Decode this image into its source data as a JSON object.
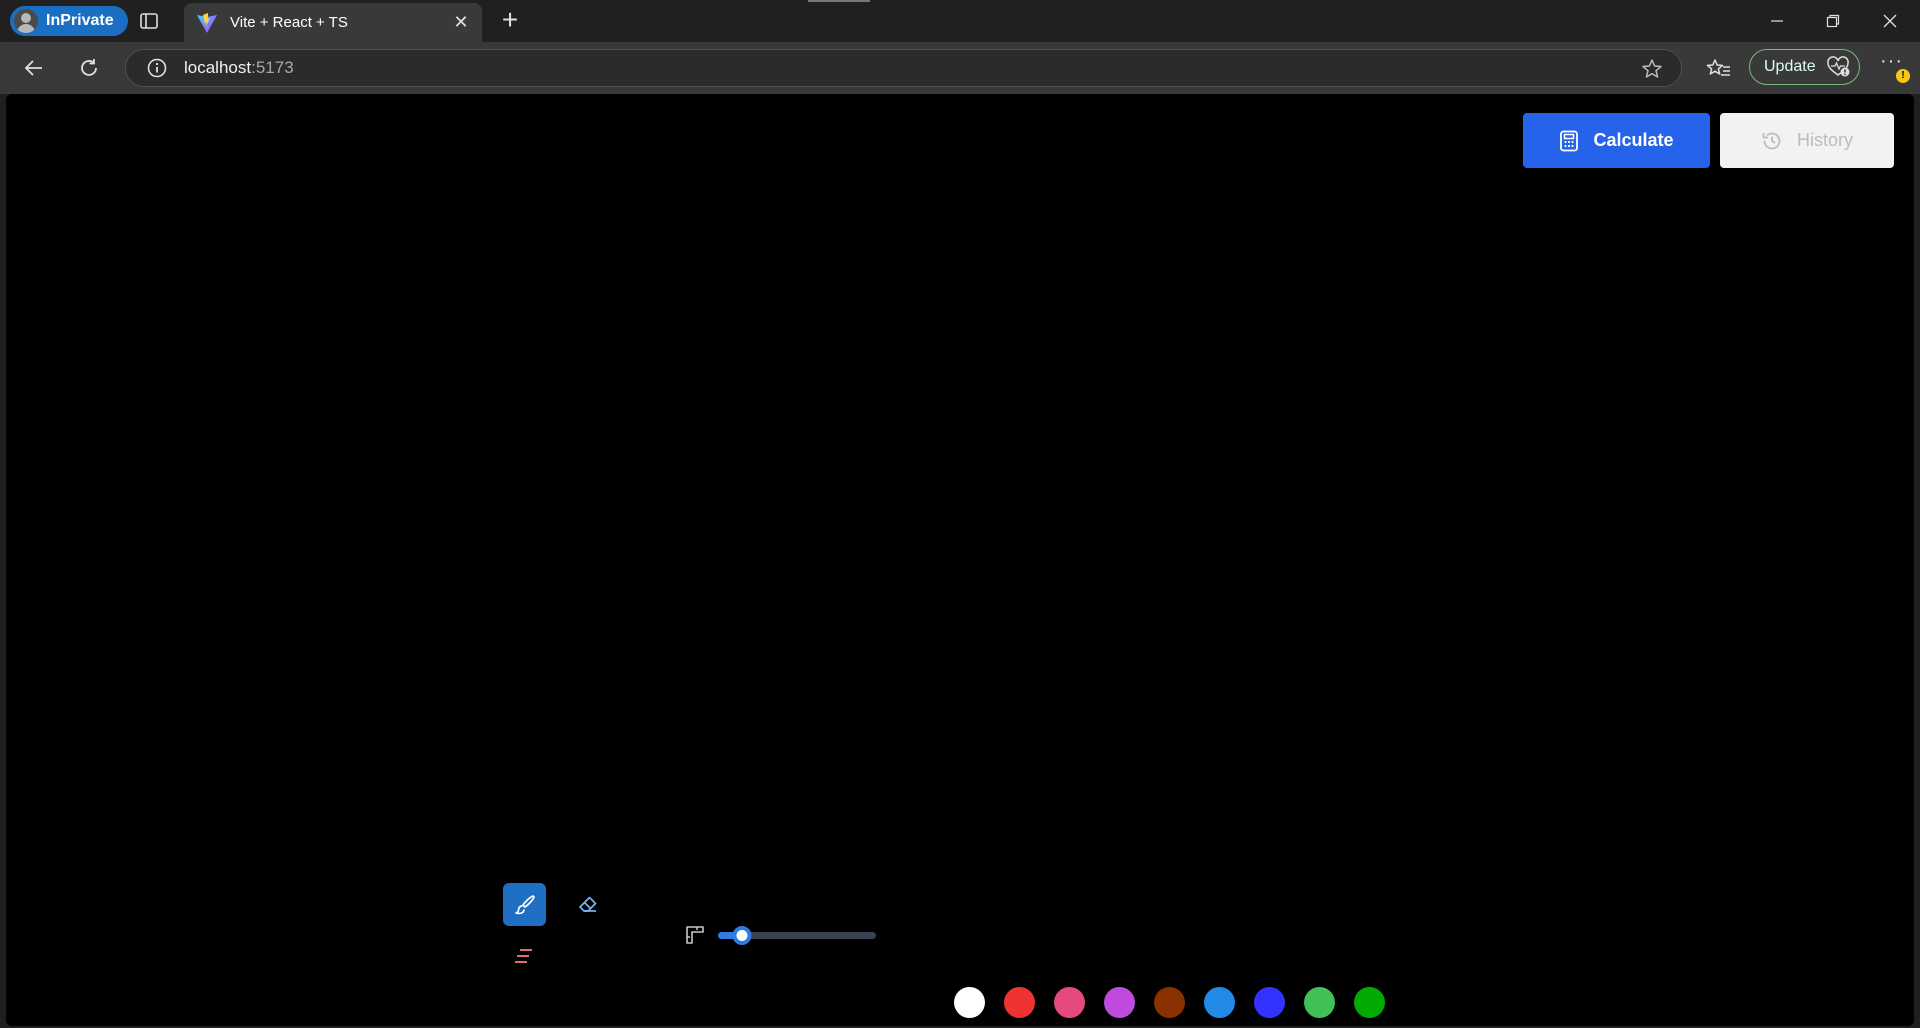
{
  "browser": {
    "profile_label": "InPrivate",
    "tab_title": "Vite + React + TS",
    "url_host": "localhost",
    "url_port": ":5173",
    "update_label": "Update"
  },
  "page": {
    "calculate_label": "Calculate",
    "history_label": "History",
    "brush_size_fraction": 0.15,
    "swatches": [
      "#000000",
      "#ffffff",
      "#ee3333",
      "#e64980",
      "#be4bdb",
      "#893200",
      "#228be6",
      "#3333ff",
      "#40c057",
      "#00aa00",
      "#fab005",
      "#fd7e14"
    ]
  }
}
